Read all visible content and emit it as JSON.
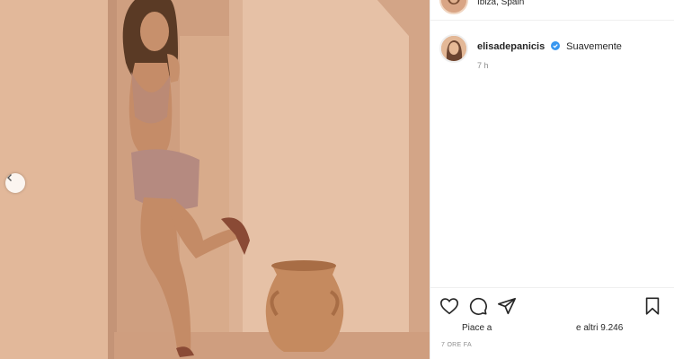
{
  "post": {
    "location": "Ibiza, Spain",
    "username": "elisadepanicis",
    "caption": "Suavemente",
    "relative_time": "7 h",
    "likes_prefix": "Piace a",
    "likes_suffix": "e altri 9.246",
    "date_label": "7 ORE FA",
    "verified": true
  },
  "icons": {
    "prev": "chevron-left-icon",
    "like": "heart-icon",
    "comment": "comment-icon",
    "share": "share-icon",
    "save": "bookmark-icon",
    "verified": "verified-badge-icon"
  },
  "colors": {
    "verified_blue": "#3897f0",
    "muted_text": "#8e8e8e",
    "text": "#262626"
  }
}
